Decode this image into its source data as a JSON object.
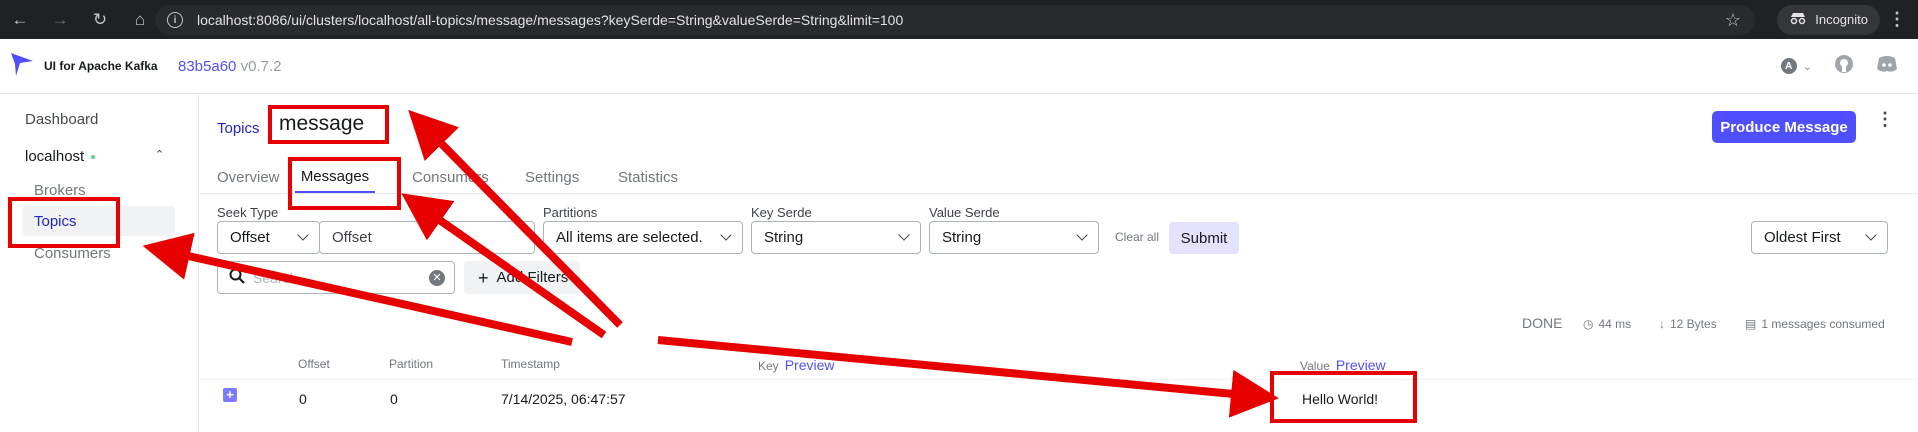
{
  "browser": {
    "url_host": "localhost",
    "url_path": ":8086/ui/clusters/localhost/all-topics/message/messages?keySerde=String&valueSerde=String&limit=100",
    "incognito_label": "Incognito"
  },
  "app": {
    "title": "UI for Apache Kafka",
    "commit": "83b5a60",
    "version": "v0.7.2",
    "avatar_letter": "A"
  },
  "sidebar": {
    "dashboard": "Dashboard",
    "cluster": "localhost",
    "items": [
      {
        "label": "Brokers"
      },
      {
        "label": "Topics"
      },
      {
        "label": "Consumers"
      }
    ]
  },
  "topic": {
    "breadcrumb": "Topics",
    "name": "message",
    "produce_label": "Produce Message"
  },
  "tabs": [
    {
      "label": "Overview"
    },
    {
      "label": "Messages"
    },
    {
      "label": "Consumers"
    },
    {
      "label": "Settings"
    },
    {
      "label": "Statistics"
    }
  ],
  "filters": {
    "seek_type_label": "Seek Type",
    "seek_type_value": "Offset",
    "offset_placeholder": "Offset",
    "partitions_label": "Partitions",
    "partitions_value": "All items are selected.",
    "key_serde_label": "Key Serde",
    "key_serde_value": "String",
    "value_serde_label": "Value Serde",
    "value_serde_value": "String",
    "clear_all": "Clear all",
    "submit": "Submit",
    "sort_value": "Oldest First",
    "search_placeholder": "Search",
    "add_filters": "Add Filters"
  },
  "stats": {
    "status": "DONE",
    "time": "44 ms",
    "bytes": "12 Bytes",
    "consumed": "1 messages consumed"
  },
  "table": {
    "headers": {
      "offset": "Offset",
      "partition": "Partition",
      "timestamp": "Timestamp",
      "key": "Key",
      "value": "Value",
      "preview": "Preview"
    },
    "rows": [
      {
        "offset": "0",
        "partition": "0",
        "timestamp": "7/14/2025, 06:47:57",
        "key": "",
        "value": "Hello World!"
      }
    ]
  },
  "colors": {
    "accent": "#4f4fff",
    "annotation": "#e60000",
    "chrome": "#202124"
  }
}
